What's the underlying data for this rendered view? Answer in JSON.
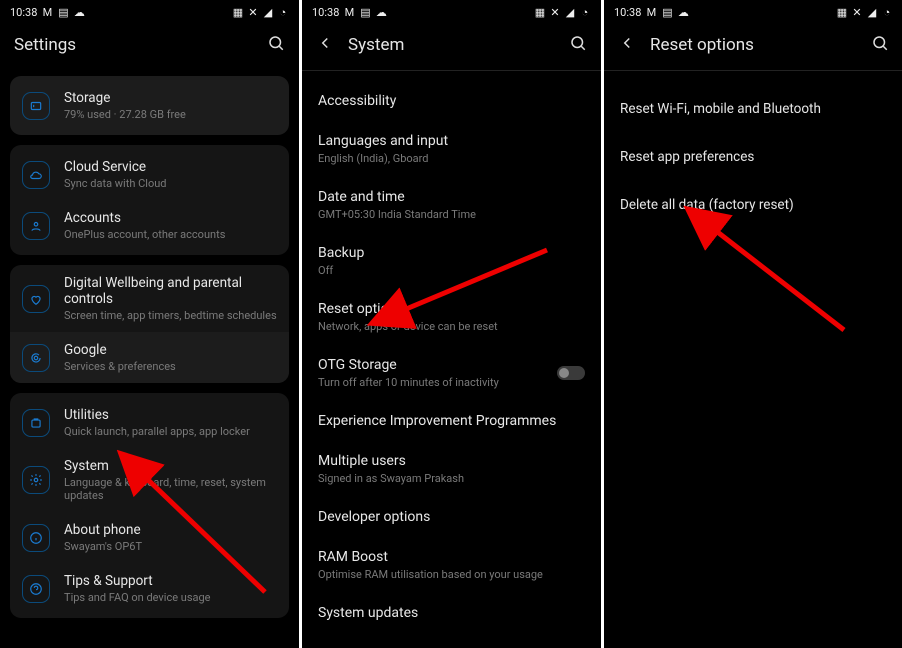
{
  "status": {
    "time": "10:38"
  },
  "screen1": {
    "title": "Settings",
    "storage": {
      "title": "Storage",
      "sub": "79% used · 27.28 GB free"
    },
    "cloud": {
      "title": "Cloud Service",
      "sub": "Sync data with Cloud"
    },
    "accounts": {
      "title": "Accounts",
      "sub": "OnePlus account, other accounts"
    },
    "wellbeing": {
      "title": "Digital Wellbeing and parental controls",
      "sub": "Screen time, app timers, bedtime schedules"
    },
    "google": {
      "title": "Google",
      "sub": "Services & preferences"
    },
    "utilities": {
      "title": "Utilities",
      "sub": "Quick launch, parallel apps, app locker"
    },
    "system": {
      "title": "System",
      "sub": "Language & keyboard, time, reset, system updates"
    },
    "about": {
      "title": "About phone",
      "sub": "Swayam's OP6T"
    },
    "tips": {
      "title": "Tips & Support",
      "sub": "Tips and FAQ on device usage"
    }
  },
  "screen2": {
    "title": "System",
    "accessibility": {
      "title": "Accessibility"
    },
    "languages": {
      "title": "Languages and input",
      "sub": "English (India), Gboard"
    },
    "datetime": {
      "title": "Date and time",
      "sub": "GMT+05:30 India Standard Time"
    },
    "backup": {
      "title": "Backup",
      "sub": "Off"
    },
    "reset": {
      "title": "Reset options",
      "sub": "Network, apps or device can be reset"
    },
    "otg": {
      "title": "OTG Storage",
      "sub": "Turn off after 10 minutes of inactivity"
    },
    "experience": {
      "title": "Experience Improvement Programmes"
    },
    "users": {
      "title": "Multiple users",
      "sub": "Signed in as Swayam Prakash"
    },
    "developer": {
      "title": "Developer options"
    },
    "ram": {
      "title": "RAM Boost",
      "sub": "Optimise RAM utilisation based on your usage"
    },
    "updates": {
      "title": "System updates"
    }
  },
  "screen3": {
    "title": "Reset options",
    "wifi": {
      "title": "Reset Wi-Fi, mobile and Bluetooth"
    },
    "prefs": {
      "title": "Reset app preferences"
    },
    "factory": {
      "title": "Delete all data (factory reset)"
    }
  }
}
